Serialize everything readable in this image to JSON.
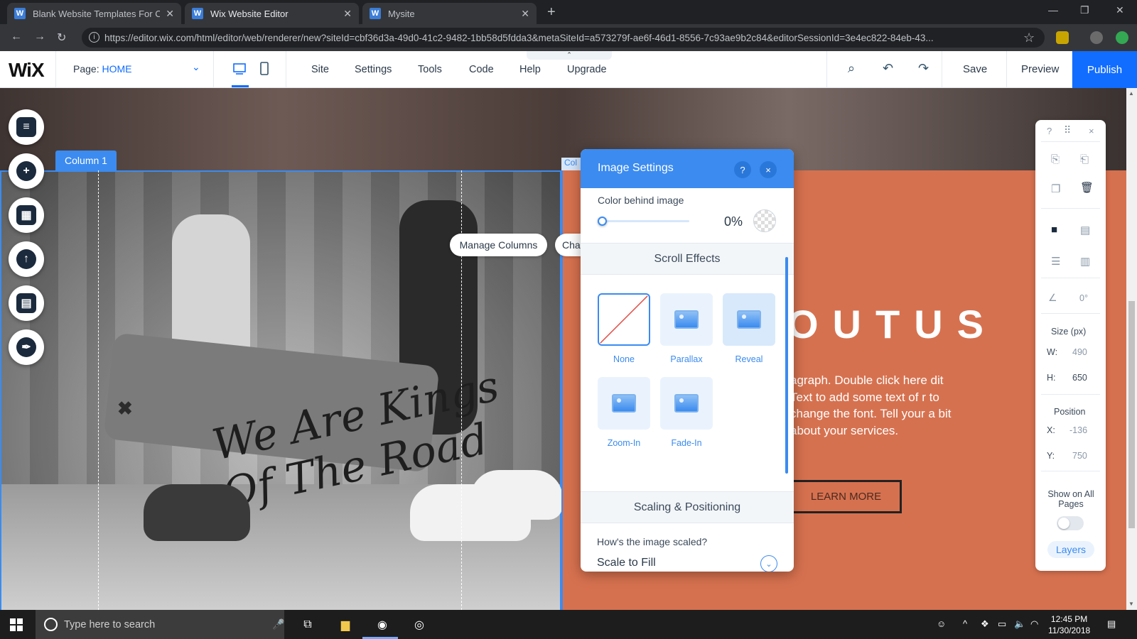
{
  "browser": {
    "tabs": [
      {
        "title": "Blank Website Templates For Cre",
        "active": false
      },
      {
        "title": "Wix Website Editor",
        "active": true
      },
      {
        "title": "Mysite",
        "active": false
      }
    ],
    "url": "https://editor.wix.com/html/editor/web/renderer/new?siteId=cbf36d3a-49d0-41c2-9482-1bb58d5fdda3&metaSiteId=a573279f-ae6f-46d1-8556-7c93ae9b2c84&editorSessionId=3e4ec822-84eb-43..."
  },
  "editor": {
    "logo": "WiX",
    "page_prefix": "Page:",
    "page_name": "HOME",
    "menu": [
      "Site",
      "Settings",
      "Tools",
      "Code",
      "Help",
      "Upgrade"
    ],
    "save": "Save",
    "preview": "Preview",
    "publish": "Publish",
    "accent": "#116dff"
  },
  "canvas": {
    "column1_label": "Column 1",
    "column2_label": "Col",
    "manage_columns": "Manage Columns",
    "change_btn": "Cha",
    "about_title": "OUTUS",
    "paragraph": "agraph. Double click here dit Text to add some text of r to change the font. Tell your a bit about your services.",
    "learn_more": "LEARN MORE",
    "board_text": "We Are Kings Of The Road",
    "column2_color": "#d6714f"
  },
  "image_settings": {
    "title": "Image Settings",
    "help": "?",
    "close": "×",
    "color_behind_label": "Color behind image",
    "color_behind_value": 0,
    "color_behind_display": "0%",
    "scroll_effects_title": "Scroll Effects",
    "effects": [
      {
        "label": "None",
        "selected": true
      },
      {
        "label": "Parallax",
        "selected": false
      },
      {
        "label": "Reveal",
        "selected": false
      },
      {
        "label": "Zoom-In",
        "selected": false
      },
      {
        "label": "Fade-In",
        "selected": false
      }
    ],
    "scaling_title": "Scaling & Positioning",
    "scaling_question": "How's the image scaled?",
    "scaling_value": "Scale to Fill"
  },
  "inspector": {
    "help": "?",
    "close": "×",
    "rotation": "0°",
    "size_title": "Size (px)",
    "w_label": "W:",
    "w_value": "490",
    "h_label": "H:",
    "h_value": "650",
    "position_title": "Position",
    "x_label": "X:",
    "x_value": "-136",
    "y_label": "Y:",
    "y_value": "750",
    "show_all_pages": "Show on All Pages",
    "layers": "Layers"
  },
  "taskbar": {
    "search_placeholder": "Type here to search",
    "time": "12:45 PM",
    "date": "11/30/2018"
  }
}
